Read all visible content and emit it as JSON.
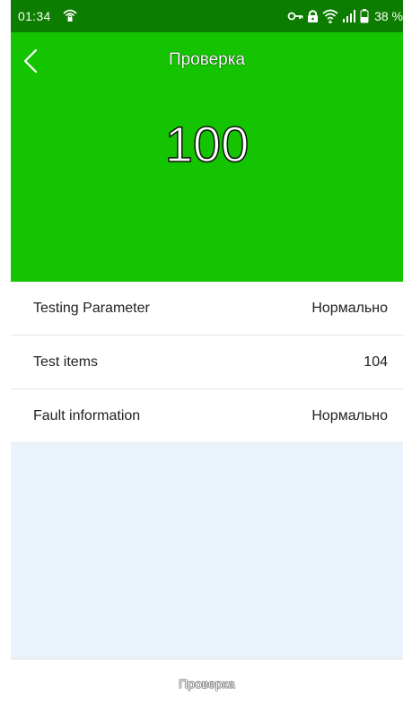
{
  "status_bar": {
    "time": "01:34",
    "battery": "38 %",
    "icons": [
      "wifi-lock-icon",
      "key-icon",
      "lock-icon",
      "wifi-icon",
      "signal-icon",
      "battery-icon"
    ]
  },
  "header": {
    "title": "Проверка",
    "score": "100",
    "back_icon": "chevron-left-icon"
  },
  "info_list": [
    {
      "label": "Testing Parameter",
      "value": "Нормально"
    },
    {
      "label": "Test items",
      "value": "104"
    },
    {
      "label": "Fault information",
      "value": "Нормально"
    }
  ],
  "bottom_bar": {
    "button_label": "Проверка"
  },
  "colors": {
    "status_bar": "#0c7d00",
    "header": "#14c400",
    "content_background": "#eaf3fc"
  }
}
